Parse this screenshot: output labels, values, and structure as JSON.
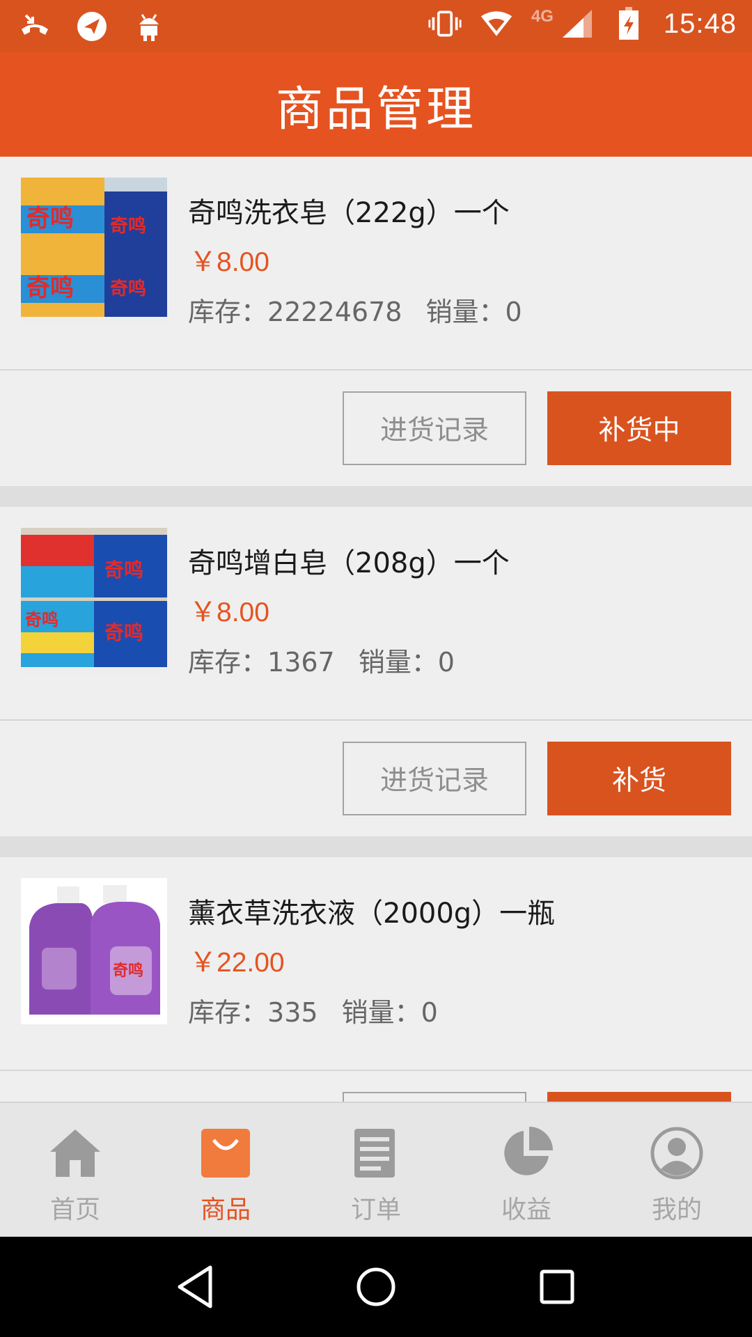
{
  "status_bar": {
    "time": "15:48",
    "network": "4G",
    "icons": [
      "missed-call-icon",
      "send-icon",
      "android-icon",
      "vibrate-icon",
      "wifi-icon",
      "signal-icon",
      "battery-charging-icon"
    ]
  },
  "header": {
    "title": "商品管理"
  },
  "colors": {
    "accent": "#e55320",
    "status_bar": "#d9531f",
    "button": "#d9531f"
  },
  "products": [
    {
      "name": "奇鸣洗衣皂（222g）一个",
      "price": "￥8.00",
      "stock_label": "库存：",
      "stock": "22224678",
      "sales_label": "销量：",
      "sales": "0",
      "record_label": "进货记录",
      "restock_label": "补货中",
      "image": "soap-box-yellow-image"
    },
    {
      "name": "奇鸣增白皂（208g）一个",
      "price": "￥8.00",
      "stock_label": "库存：",
      "stock": "1367",
      "sales_label": "销量：",
      "sales": "0",
      "record_label": "进货记录",
      "restock_label": "补货",
      "image": "soap-box-blue-image"
    },
    {
      "name": "薰衣草洗衣液（2000g）一瓶",
      "price": "￥22.00",
      "stock_label": "库存：",
      "stock": "335",
      "sales_label": "销量：",
      "sales": "0",
      "record_label": "",
      "restock_label": "",
      "image": "lavender-detergent-image"
    }
  ],
  "bottom_nav": {
    "items": [
      {
        "label": "首页",
        "icon": "home-icon"
      },
      {
        "label": "商品",
        "icon": "shopping-bag-icon",
        "active": true
      },
      {
        "label": "订单",
        "icon": "order-list-icon"
      },
      {
        "label": "收益",
        "icon": "pie-chart-icon"
      },
      {
        "label": "我的",
        "icon": "profile-icon"
      }
    ]
  },
  "system_nav": {
    "icons": [
      "back-icon",
      "home-circle-icon",
      "recents-icon"
    ]
  }
}
